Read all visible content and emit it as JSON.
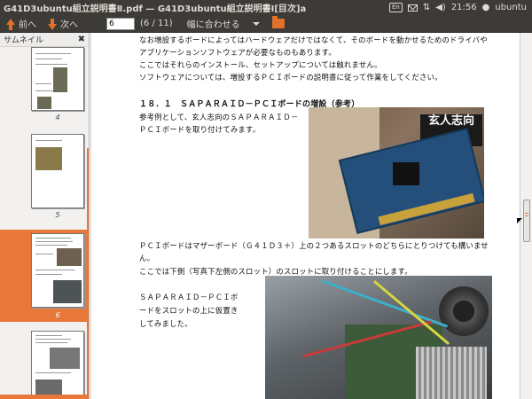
{
  "window": {
    "title": "G41D3ubuntu組立説明書Ⅱ.pdf — G41D3ubuntu組立説明書Ⅰ[目次]a"
  },
  "panel": {
    "keyboard_label": "En",
    "time": "21:56",
    "user": "ubuntu"
  },
  "toolbar": {
    "prev_label": "前へ",
    "next_label": "次へ",
    "page_value": "6",
    "page_count": "(6 / 11)",
    "zoom_label": "幅に合わせる"
  },
  "sidebar": {
    "title": "サムネイル",
    "thumbnails": [
      {
        "label": "4"
      },
      {
        "label": "5"
      },
      {
        "label": "6",
        "selected": true
      },
      {
        "label": ""
      }
    ]
  },
  "document": {
    "lines_top": [
      "なお増設するボードによってはハードウェアだけではなくて、そのボードを動かせるためのドライバや",
      "アプリケーションソフトウェアが必要なものもあります。",
      "ここではそれらのインストール、セットアップについては触れません。",
      "ソフトウェアについては、増設するＰＣＩボードの説明書に従って作業をしてください。"
    ],
    "heading": "１８．１　ＳＡＰＡＲＡＩＤ－ＰＣＩボードの増設（参考）",
    "para1": [
      "参考例として、玄人志向のＳＡＰＡＲＡＩＤ－",
      "ＰＣＩボードを取り付けてみます。"
    ],
    "para2": [
      "ＰＣＩボードはマザーボード（Ｇ４１Ｄ３＋）上の２つあるスロットのどちらにとりつけても構いませ",
      "ん。",
      "ここでは下側（写真下左側のスロット）のスロットに取り付けることにします。"
    ],
    "para3": [
      "ＳＡＰＡＲＡＩＤ－ＰＣＩボ",
      "ードをスロットの上に仮置き",
      "してみました。"
    ],
    "photo1_label": "玄人志向"
  }
}
